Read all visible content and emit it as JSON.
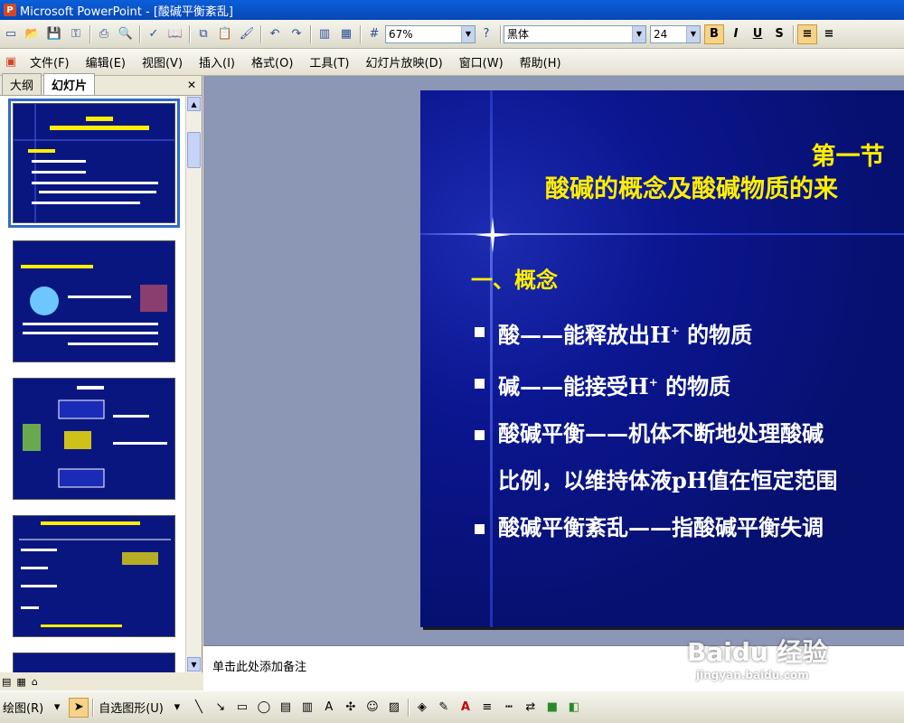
{
  "window": {
    "title": "Microsoft PowerPoint - [酸碱平衡紊乱]"
  },
  "toolbar": {
    "zoom": "67%",
    "font_name": "黑体",
    "font_size": "24",
    "bold": "B",
    "italic": "I",
    "underline": "U",
    "shadow": "S"
  },
  "menu": {
    "items": [
      "文件(F)",
      "编辑(E)",
      "视图(V)",
      "插入(I)",
      "格式(O)",
      "工具(T)",
      "幻灯片放映(D)",
      "窗口(W)",
      "帮助(H)"
    ]
  },
  "left_pane": {
    "tabs": [
      "大纲",
      "幻灯片"
    ],
    "active_tab": "幻灯片"
  },
  "slide": {
    "title_line1": "第一节",
    "title_line2": "酸碱的概念及酸碱物质的来",
    "heading": "一、概念",
    "bullets": [
      {
        "text": "酸——能释放出H",
        "sup": "+",
        "tail": " 的物质"
      },
      {
        "text": "碱——能接受H",
        "sup": "+",
        "tail": " 的物质"
      },
      {
        "text": "酸碱平衡——机体不断地处理酸碱",
        "sup": "",
        "tail": ""
      },
      {
        "text": "比例，以维持体液pH值在恒定范围",
        "sup": "",
        "tail": ""
      },
      {
        "text": "酸碱平衡紊乱——指酸碱平衡失调",
        "sup": "",
        "tail": ""
      }
    ]
  },
  "notes": {
    "placeholder": "单击此处添加备注"
  },
  "drawbar": {
    "draw_label": "绘图(R)",
    "autoshapes_label": "自选图形(U)"
  },
  "watermark": {
    "main": "Baidu 经验",
    "sub": "jingyan.baidu.com"
  },
  "colors": {
    "slide_bg": "#0b1690",
    "title_yellow": "#ffee00",
    "titlebar": "#0a5fd8"
  }
}
